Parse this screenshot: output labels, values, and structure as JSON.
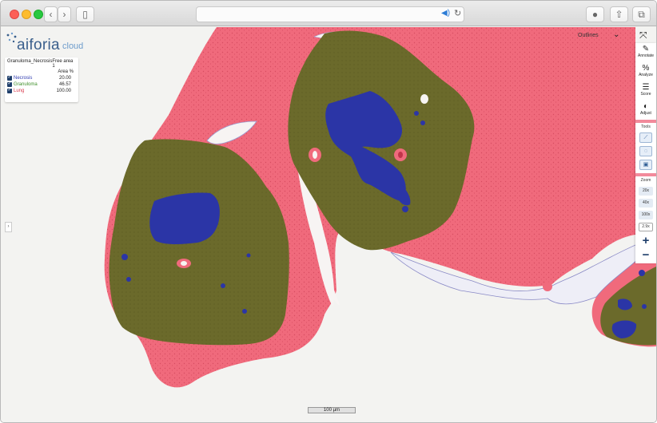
{
  "app": {
    "logo_text": "aiforia",
    "logo_sub": "cloud"
  },
  "legend": {
    "title": "Granuloma_Necrosis",
    "area_name": "Free area 1",
    "column_header": "Area %",
    "rows": [
      {
        "name": "Necrosis",
        "value": "20.00",
        "color": "#2f3bb0"
      },
      {
        "name": "Granuloma",
        "value": "46.57",
        "color": "#3f8f2a"
      },
      {
        "name": "Lung",
        "value": "100.00",
        "color": "#d83a4d"
      }
    ]
  },
  "top_controls": {
    "outlines_label": "Outlines"
  },
  "toolbar": {
    "annotate": "Annotate",
    "analyze": "Analyze",
    "score": "Score",
    "adjust": "Adjust",
    "tools_label": "Tools",
    "zoom_label": "Zoom",
    "zoom_presets": [
      "20x",
      "40x",
      "100x"
    ],
    "zoom_level": "2.9x",
    "zoom_in": "+",
    "zoom_out": "−"
  },
  "scale_bar": {
    "label": "100 µm"
  },
  "colors": {
    "lung": "#f06a7c",
    "granuloma": "#6b6a2b",
    "necrosis": "#2b35a6",
    "background": "#f3f3f1"
  }
}
